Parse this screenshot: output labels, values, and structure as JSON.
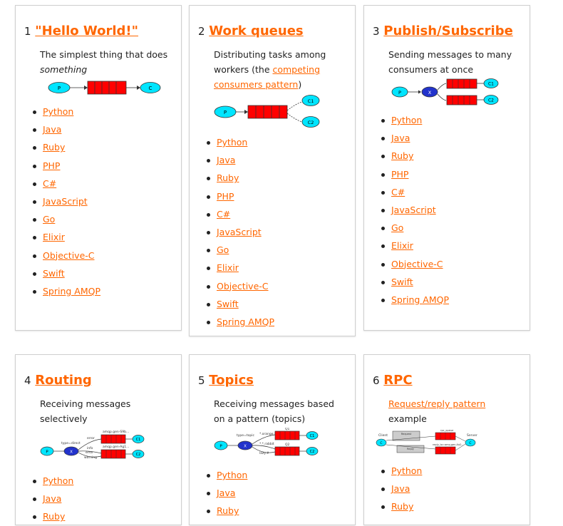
{
  "tutorials": [
    {
      "number": "1",
      "title": "\"Hello World!\"",
      "desc_text": "The simplest thing that does",
      "desc_em": "something",
      "langs": [
        "Python",
        "Java",
        "Ruby",
        "PHP",
        "C#",
        "JavaScript",
        "Go",
        "Elixir",
        "Objective-C",
        "Swift",
        "Spring AMQP"
      ]
    },
    {
      "number": "2",
      "title": "Work queues",
      "desc_before": "Distributing tasks among workers (the ",
      "desc_link": "competing consumers pattern",
      "desc_after": ")",
      "langs": [
        "Python",
        "Java",
        "Ruby",
        "PHP",
        "C#",
        "JavaScript",
        "Go",
        "Elixir",
        "Objective-C",
        "Swift",
        "Spring AMQP"
      ]
    },
    {
      "number": "3",
      "title": "Publish/Subscribe",
      "desc_text": "Sending messages to many consumers at once",
      "langs": [
        "Python",
        "Java",
        "Ruby",
        "PHP",
        "C#",
        "JavaScript",
        "Go",
        "Elixir",
        "Objective-C",
        "Swift",
        "Spring AMQP"
      ]
    },
    {
      "number": "4",
      "title": "Routing",
      "desc_text": "Receiving messages selectively",
      "langs": [
        "Python",
        "Java",
        "Ruby"
      ]
    },
    {
      "number": "5",
      "title": "Topics",
      "desc_text": "Receiving messages based on a pattern (topics)",
      "langs": [
        "Python",
        "Java",
        "Ruby"
      ]
    },
    {
      "number": "6",
      "title": "RPC",
      "desc_link": "Request/reply pattern",
      "desc_after": "example",
      "langs": [
        "Python",
        "Java",
        "Ruby"
      ]
    }
  ],
  "diagram_labels": {
    "producer": "P",
    "consumer": "C",
    "c1": "C1",
    "c2": "C2",
    "exchange": "X",
    "routing_error": "error",
    "routing_info": "info",
    "routing_warning": "warning",
    "routing_type": "type=direct",
    "routing_q1": "amqp.gen-S9b...",
    "routing_q2": "amqp.gen-Ag1...",
    "topics_type": "type=topic",
    "topics_b1": "*.orange.*",
    "topics_b2": "*.*.rabbit",
    "topics_b3": "lazy.#",
    "q1": "Q1",
    "q2": "Q2",
    "rpc_client": "Client",
    "rpc_server": "Server",
    "rpc_request": "Request",
    "rpc_reply": "Reply",
    "rpc_queue": "rpc_queue",
    "rpc_reply_to": "reply_to=amq.gen-Xa2..."
  },
  "colors": {
    "accent": "#ff6600",
    "queue": "#ff0000",
    "node": "#00e5ff",
    "exchange": "#2233cc"
  }
}
